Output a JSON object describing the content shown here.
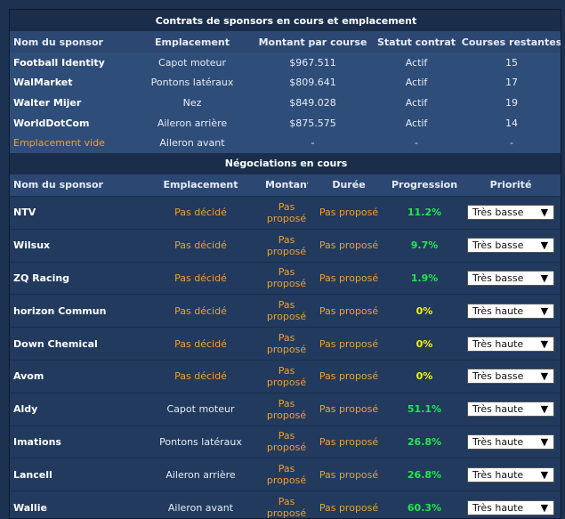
{
  "contracts": {
    "title": "Contrats de sponsors en cours et emplacement",
    "headers": [
      "Nom du sponsor",
      "Emplacement",
      "Montant par course",
      "Statut contrat",
      "Courses restantes"
    ],
    "rows": [
      {
        "name": "Football Identity",
        "location": "Capot moteur",
        "amount": "$967.511",
        "status": "Actif",
        "remaining": "15"
      },
      {
        "name": "WalMarket",
        "location": "Pontons latéraux",
        "amount": "$809.641",
        "status": "Actif",
        "remaining": "17"
      },
      {
        "name": "Walter Mijer",
        "location": "Nez",
        "amount": "$849.028",
        "status": "Actif",
        "remaining": "19"
      },
      {
        "name": "WorldDotCom",
        "location": "Aileron arrière",
        "amount": "$875.575",
        "status": "Actif",
        "remaining": "14"
      },
      {
        "name": "Emplacement vide",
        "location": "Aileron avant",
        "amount": "-",
        "status": "-",
        "remaining": "-"
      }
    ]
  },
  "negotiations": {
    "title": "Négociations en cours",
    "headers": [
      "Nom du sponsor",
      "Emplacement",
      "Montant",
      "Durée",
      "Progression",
      "Priorité"
    ],
    "rows": [
      {
        "name": "NTV",
        "location": "Pas décidé",
        "amount": "Pas proposé",
        "duration": "Pas proposé",
        "progress": "11.2%",
        "priority": "Très basse"
      },
      {
        "name": "Wilsux",
        "location": "Pas décidé",
        "amount": "Pas proposé",
        "duration": "Pas proposé",
        "progress": "9.7%",
        "priority": "Très basse"
      },
      {
        "name": "ZQ Racing",
        "location": "Pas décidé",
        "amount": "Pas proposé",
        "duration": "Pas proposé",
        "progress": "1.9%",
        "priority": "Très basse"
      },
      {
        "name": "horizon Commun",
        "location": "Pas décidé",
        "amount": "Pas proposé",
        "duration": "Pas proposé",
        "progress": "0%",
        "priority": "Très haute"
      },
      {
        "name": "Down Chemical",
        "location": "Pas décidé",
        "amount": "Pas proposé",
        "duration": "Pas proposé",
        "progress": "0%",
        "priority": "Très haute"
      },
      {
        "name": "Avom",
        "location": "Pas décidé",
        "amount": "Pas proposé",
        "duration": "Pas proposé",
        "progress": "0%",
        "priority": "Très basse"
      },
      {
        "name": "Aldy",
        "location": "Capot moteur",
        "amount": "Pas proposé",
        "duration": "Pas proposé",
        "progress": "51.1%",
        "priority": "Très haute"
      },
      {
        "name": "Imations",
        "location": "Pontons latéraux",
        "amount": "Pas proposé",
        "duration": "Pas proposé",
        "progress": "26.8%",
        "priority": "Très haute"
      },
      {
        "name": "Lancell",
        "location": "Aileron arrière",
        "amount": "Pas proposé",
        "duration": "Pas proposé",
        "progress": "26.8%",
        "priority": "Très haute"
      },
      {
        "name": "Wallie",
        "location": "Aileron avant",
        "amount": "Pas proposé",
        "duration": "Pas proposé",
        "progress": "60.3%",
        "priority": "Très haute"
      }
    ]
  },
  "colors": {
    "background": "#1d3250",
    "panel": "#2c4872",
    "header_bar": "#1a2e4b",
    "orange_text": "#f0a030",
    "progress_green": "#22e84a",
    "progress_yellow": "#f2f020"
  },
  "icons": {
    "dropdown": "triangle-down-icon"
  }
}
